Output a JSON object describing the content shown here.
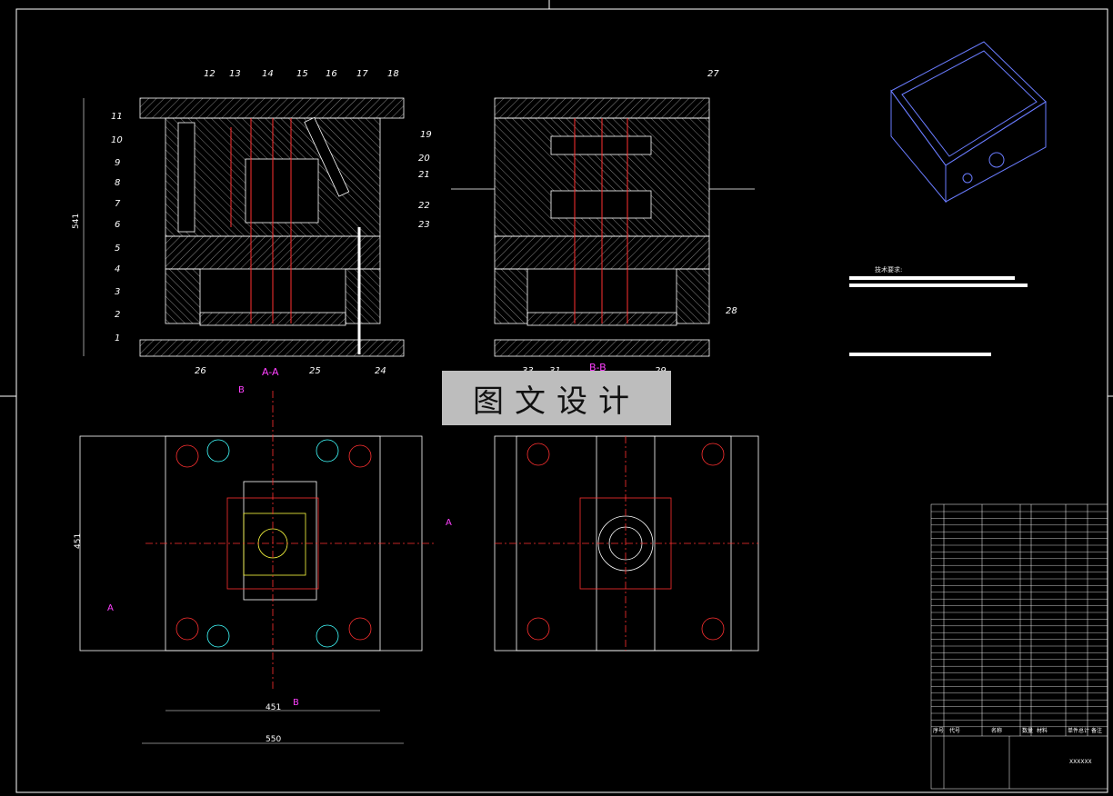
{
  "watermark": "图文设计",
  "tech_title": "技术要求:",
  "section_labels": {
    "aa": "A-A",
    "bb": "B-B",
    "a": "A",
    "b": "B"
  },
  "dimensions": {
    "height": "541",
    "width_plan": "451",
    "width_outer": "550",
    "height_plan": "451"
  },
  "part_callouts_left": [
    "11",
    "10",
    "9",
    "8",
    "7",
    "6",
    "5",
    "4",
    "3",
    "2",
    "1"
  ],
  "part_callouts_top": [
    "12",
    "13",
    "14",
    "15",
    "16",
    "17",
    "18"
  ],
  "part_callouts_right": [
    "19",
    "20",
    "21",
    "22",
    "23"
  ],
  "part_callouts_bottom": [
    "26",
    "25",
    "24"
  ],
  "part_callouts_section2": [
    "27",
    "28",
    "33",
    "31",
    "30",
    "29"
  ],
  "bom_headers": [
    "序号",
    "代号",
    "名称",
    "数量",
    "材料",
    "单件",
    "总计",
    "备注"
  ],
  "title_block_code": "XXXXXX",
  "colors": {
    "line": "#ffffff",
    "cut": "#ff3030",
    "hidden": "#ffff40",
    "accent": "#ff40ff",
    "cyan": "#40ffff",
    "blue": "#6a7cff",
    "green": "#40ff40"
  }
}
